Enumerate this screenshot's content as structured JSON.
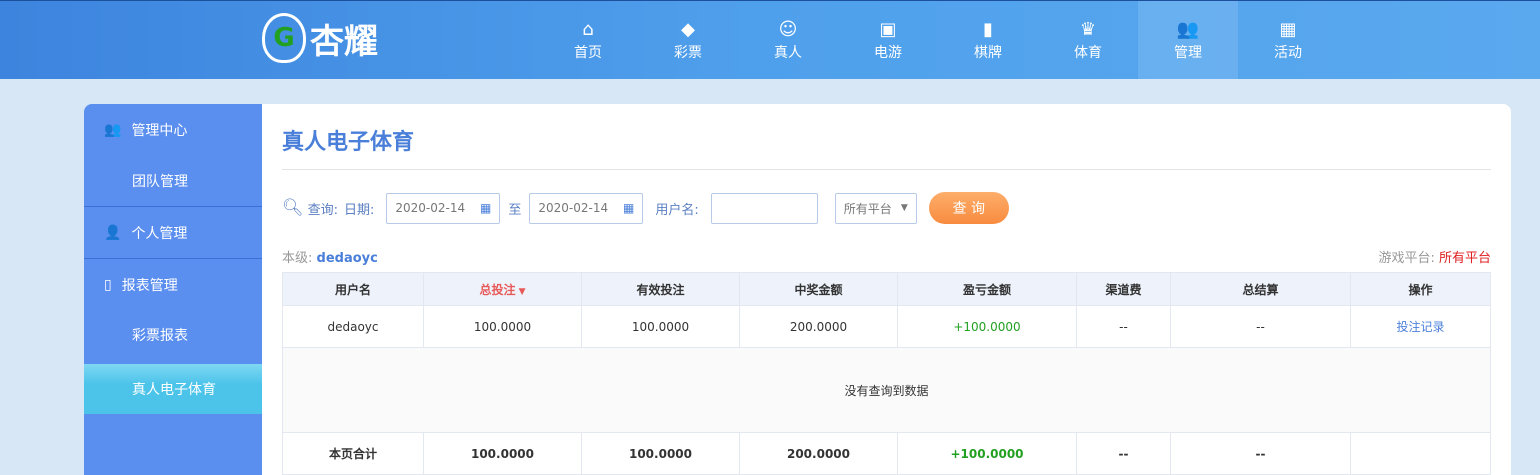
{
  "logo": {
    "text": "杏耀",
    "mark": "G"
  },
  "nav": [
    {
      "label": "首页",
      "icon": "home-icon",
      "g": "⌂"
    },
    {
      "label": "彩票",
      "icon": "ticket-icon",
      "g": "◆"
    },
    {
      "label": "真人",
      "icon": "dealer-icon",
      "g": "☺"
    },
    {
      "label": "电游",
      "icon": "slot-icon",
      "g": "▣"
    },
    {
      "label": "棋牌",
      "icon": "cards-icon",
      "g": "▮"
    },
    {
      "label": "体育",
      "icon": "trophy-icon",
      "g": "♛"
    },
    {
      "label": "管理",
      "icon": "users-icon",
      "g": "👥"
    },
    {
      "label": "活动",
      "icon": "gift-icon",
      "g": "▦"
    }
  ],
  "sidebar": {
    "h1": "管理中心",
    "s1": "团队管理",
    "h2": "个人管理",
    "h3": "报表管理",
    "s3a": "彩票报表",
    "s3b": "真人电子体育"
  },
  "page": {
    "title": "真人电子体育"
  },
  "query": {
    "label": "查询:",
    "date_label": "日期:",
    "from": "2020-02-14",
    "to_label": "至",
    "to": "2020-02-14",
    "user_label": "用户名:",
    "user_value": "",
    "platform": "所有平台",
    "submit": "查 询"
  },
  "level": {
    "label": "本级:",
    "user": "dedaoyc"
  },
  "platform_info": {
    "label": "游戏平台:",
    "value": "所有平台"
  },
  "table": {
    "headers": [
      "用户名",
      "总投注",
      "有效投注",
      "中奖金额",
      "盈亏金额",
      "渠道费",
      "总结算",
      "操作"
    ],
    "row": [
      "dedaoyc",
      "100.0000",
      "100.0000",
      "200.0000",
      "+100.0000",
      "--",
      "--",
      "投注记录"
    ],
    "empty": "没有查询到数据",
    "total": [
      "本页合计",
      "100.0000",
      "100.0000",
      "200.0000",
      "+100.0000",
      "--",
      "--",
      ""
    ]
  }
}
